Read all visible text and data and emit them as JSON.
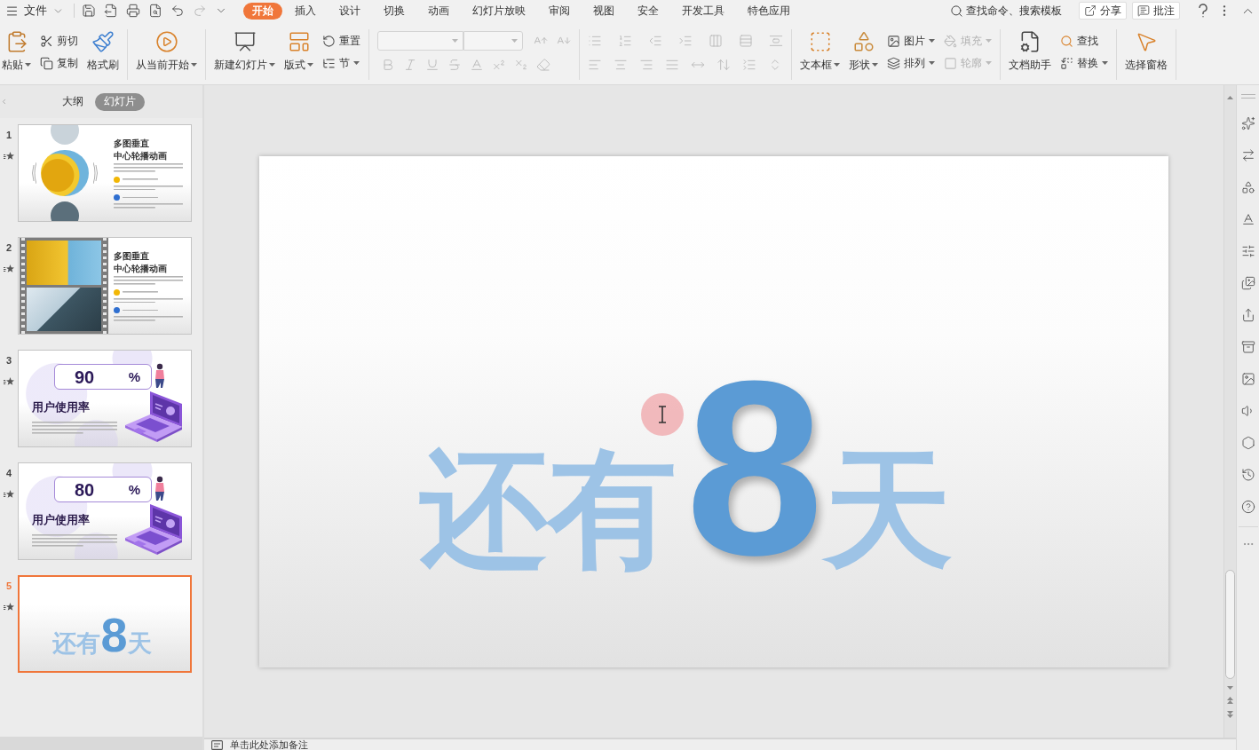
{
  "menu_bar": {
    "file_menu": {
      "label": "文件"
    },
    "tabs": [
      {
        "label": "开始",
        "selected": true
      },
      {
        "label": "插入",
        "selected": false
      },
      {
        "label": "设计",
        "selected": false
      },
      {
        "label": "切换",
        "selected": false
      },
      {
        "label": "动画",
        "selected": false
      },
      {
        "label": "幻灯片放映",
        "selected": false
      },
      {
        "label": "审阅",
        "selected": false
      },
      {
        "label": "视图",
        "selected": false
      },
      {
        "label": "安全",
        "selected": false
      },
      {
        "label": "开发工具",
        "selected": false
      },
      {
        "label": "特色应用",
        "selected": false
      }
    ],
    "search": {
      "label": "查找命令、搜索模板"
    },
    "share_button": {
      "label": "分享"
    },
    "comment_button": {
      "label": "批注"
    }
  },
  "ribbon": {
    "clipboard": {
      "paste": {
        "label": "粘贴",
        "kind": "large",
        "dropdown": true,
        "disabled": false
      },
      "cut": {
        "label": "剪切",
        "kind": "small",
        "dropdown": false,
        "disabled": false
      },
      "copy": {
        "label": "复制",
        "kind": "small",
        "dropdown": false,
        "disabled": false
      },
      "format_painter": {
        "label": "格式刷",
        "kind": "large",
        "dropdown": false,
        "disabled": false
      }
    },
    "slideshow": {
      "from_current": {
        "label": "从当前开始",
        "kind": "large",
        "dropdown": true,
        "disabled": false
      }
    },
    "slides": {
      "new_slide": {
        "label": "新建幻灯片",
        "kind": "large",
        "dropdown": true,
        "disabled": false
      },
      "layout": {
        "label": "版式",
        "kind": "large",
        "dropdown": true,
        "disabled": false
      },
      "reset": {
        "label": "重置",
        "kind": "small",
        "dropdown": false,
        "disabled": false
      },
      "section": {
        "label": "节",
        "kind": "small",
        "dropdown": true,
        "disabled": false
      }
    },
    "font": {
      "disabled": true
    },
    "paragraph": {
      "disabled": true
    },
    "drawing": {
      "text_box": {
        "label": "文本框",
        "kind": "large",
        "dropdown": true,
        "disabled": false
      },
      "shape": {
        "label": "形状",
        "kind": "large",
        "dropdown": true,
        "disabled": false
      },
      "picture": {
        "label": "图片",
        "kind": "small",
        "dropdown": true,
        "disabled": false
      },
      "arrange": {
        "label": "排列",
        "kind": "small",
        "dropdown": true,
        "disabled": false
      },
      "fill": {
        "label": "填充",
        "kind": "small",
        "dropdown": true,
        "disabled": true
      },
      "outline": {
        "label": "轮廓",
        "kind": "small",
        "dropdown": true,
        "disabled": true
      }
    },
    "editing": {
      "doc_assistant": {
        "label": "文档助手",
        "kind": "large",
        "dropdown": false,
        "disabled": false
      },
      "find": {
        "label": "查找",
        "kind": "small",
        "dropdown": false,
        "disabled": false
      },
      "replace": {
        "label": "替换",
        "kind": "small",
        "dropdown": true,
        "disabled": false
      }
    },
    "selection": {
      "selection_pane": {
        "label": "选择窗格",
        "kind": "large",
        "dropdown": false,
        "disabled": false
      }
    }
  },
  "slide_panel": {
    "tabs": [
      {
        "label": "大纲",
        "selected": false
      },
      {
        "label": "幻灯片",
        "selected": true
      }
    ],
    "slides": [
      {
        "number": "1",
        "selected": false,
        "animated": true,
        "kind": "carousel",
        "title": "多图垂直",
        "subtitle": "中心轮播动画"
      },
      {
        "number": "2",
        "selected": false,
        "animated": true,
        "kind": "filmstrip",
        "title": "多图垂直",
        "subtitle": "中心轮播动画"
      },
      {
        "number": "3",
        "selected": false,
        "animated": true,
        "kind": "usage",
        "value": "90",
        "unit": "%",
        "heading": "用户使用率"
      },
      {
        "number": "4",
        "selected": false,
        "animated": true,
        "kind": "usage",
        "value": "80",
        "unit": "%",
        "heading": "用户使用率"
      },
      {
        "number": "5",
        "selected": true,
        "animated": true,
        "kind": "countdown",
        "before": "还有",
        "count": "8",
        "after": "天"
      }
    ]
  },
  "slide": {
    "before": "还有",
    "count": "8",
    "after": "天"
  },
  "notes": {
    "placeholder": "单击此处添加备注"
  }
}
